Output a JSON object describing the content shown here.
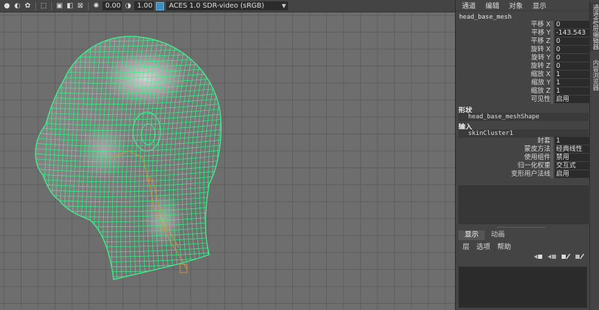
{
  "viewport_toolbar": {
    "icons": [
      "shading-icon",
      "wireframe-icon",
      "lighting-icon",
      "select-box-icon",
      "isolate-icon",
      "xray-icon",
      "grid-toggle-icon",
      "exposure-icon",
      "gamma-icon",
      "colorspace-icon"
    ],
    "exposure": "0.00",
    "gamma": "1.00",
    "color_space": "ACES 1.0 SDR-video (sRGB)"
  },
  "channel_box": {
    "menu": [
      "通道",
      "编辑",
      "对象",
      "显示"
    ],
    "object_name": "head_base_mesh",
    "attributes": [
      {
        "label": "平移 X",
        "value": "0"
      },
      {
        "label": "平移 Y",
        "value": "-143.543"
      },
      {
        "label": "平移 Z",
        "value": "0"
      },
      {
        "label": "旋转 X",
        "value": "0"
      },
      {
        "label": "旋转 Y",
        "value": "0"
      },
      {
        "label": "旋转 Z",
        "value": "0"
      },
      {
        "label": "缩放 X",
        "value": "1"
      },
      {
        "label": "缩放 Y",
        "value": "1"
      },
      {
        "label": "缩放 Z",
        "value": "1"
      },
      {
        "label": "可见性",
        "value": "启用"
      }
    ],
    "shapes_header": "形状",
    "shape_name": "head_base_meshShape",
    "inputs_header": "输入",
    "input_name": "skinCluster1",
    "input_attributes": [
      {
        "label": "封套",
        "value": "1"
      },
      {
        "label": "蒙皮方法",
        "value": "经典线性"
      },
      {
        "label": "使用组件",
        "value": "禁用"
      },
      {
        "label": "归一化权重",
        "value": "交互式"
      },
      {
        "label": "变形用户法线",
        "value": "启用"
      }
    ]
  },
  "layer_editor": {
    "tabs": [
      "显示",
      "动画"
    ],
    "active_tab": "显示",
    "menu": [
      "层",
      "选项",
      "帮助"
    ],
    "icons": [
      "new-layer-icon",
      "new-layer-selected-icon",
      "move-layer-up-icon",
      "move-layer-down-icon"
    ]
  },
  "side_tabs": [
    "通道盒/层编辑器",
    "内容浏览器"
  ],
  "colors": {
    "viewport_bg": "#6e6e6e",
    "grid_line": "#5e5e5e",
    "wireframe": "#3cf08c",
    "joint": "#c79a3c"
  }
}
